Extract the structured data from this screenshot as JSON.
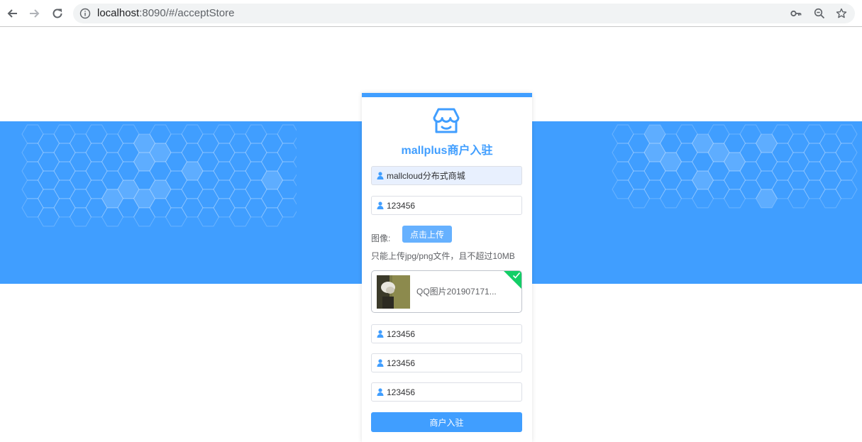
{
  "browser": {
    "url_host": "localhost",
    "url_rest": ":8090/#/acceptStore",
    "icons": [
      "back-icon",
      "forward-icon",
      "reload-icon",
      "info-icon",
      "key-icon",
      "zoom-icon",
      "star-icon"
    ]
  },
  "colors": {
    "primary": "#409eff",
    "button_light": "#66b1ff",
    "success": "#13ce66"
  },
  "form": {
    "title": "mallplus商户入驻",
    "field1": "mallcloud分布式商城",
    "field2": "123456",
    "upload_label": "图像:",
    "upload_button": "点击上传",
    "upload_tip": "只能上传jpg/png文件，且不超过10MB",
    "file_name": "QQ图片201907171...",
    "field3": "123456",
    "field4": "123456",
    "field5": "123456",
    "submit": "商户入驻"
  }
}
